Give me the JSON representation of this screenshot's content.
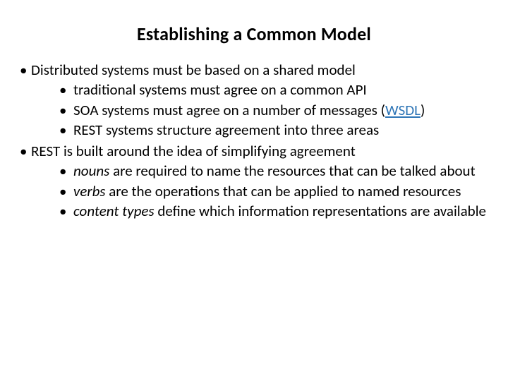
{
  "title": "Establishing a Common Model",
  "b1": "Distributed systems must be based on a shared model",
  "b1_1": "traditional systems must agree on a common API",
  "b1_2a": "SOA systems must agree on a number of messages (",
  "b1_2link": "WSDL",
  "b1_2b": ")",
  "b1_3": "REST systems structure agreement into three areas",
  "b2": "REST is built around the idea of simplifying agreement",
  "b2_1_em": "nouns",
  "b2_1_rest": " are required to name the resources that can be talked about",
  "b2_2_em": "verbs",
  "b2_2_rest": " are the operations that can be applied to named resources",
  "b2_3_em": "content types",
  "b2_3_rest": " define which information representations are available",
  "link_href": "#"
}
